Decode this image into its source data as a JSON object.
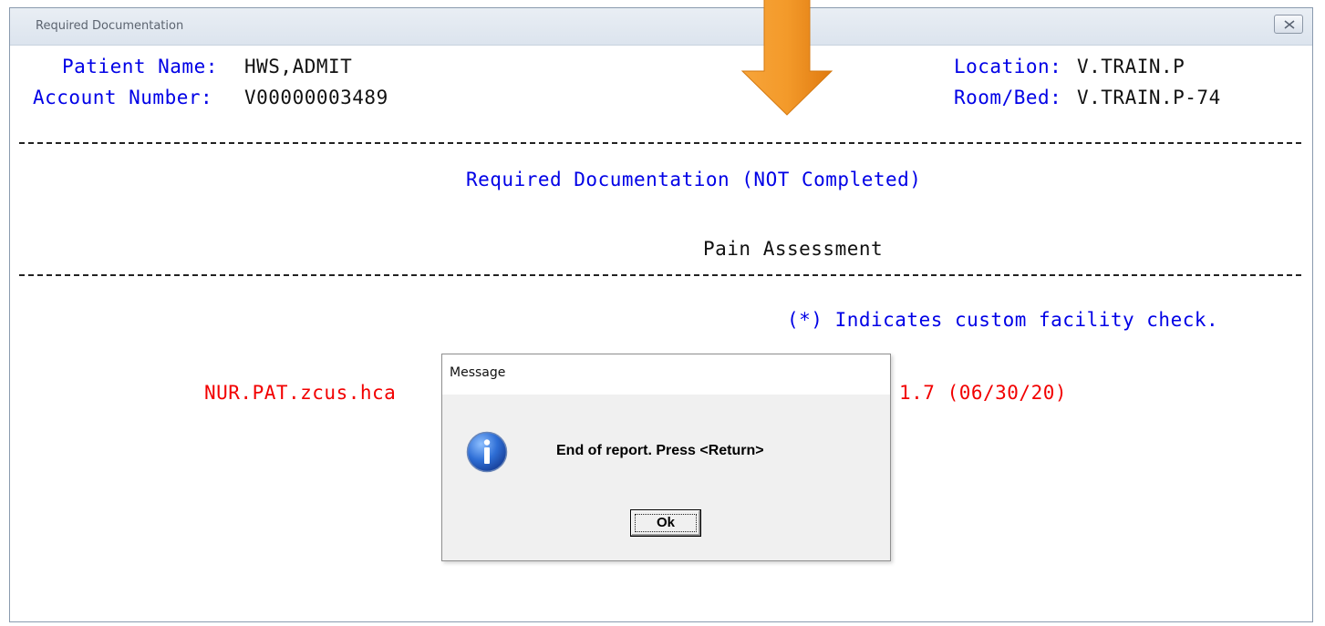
{
  "window": {
    "title": "Required Documentation"
  },
  "header": {
    "patient_name_label": "Patient Name:",
    "patient_name_value": "HWS,ADMIT",
    "account_number_label": "Account Number:",
    "account_number_value": "V00000003489",
    "location_label": "Location:",
    "location_value": "V.TRAIN.P",
    "room_bed_label": "Room/Bed:",
    "room_bed_value": "V.TRAIN.P-74"
  },
  "report": {
    "heading": "Required Documentation (NOT Completed)",
    "item": "Pain Assessment",
    "legend": "(*) Indicates custom facility check.",
    "footer_left": "NUR.PAT.zcus.hca",
    "footer_right": "1.7 (06/30/20)"
  },
  "dialog": {
    "title": "Message",
    "message": "End of report.  Press <Return>",
    "ok_label": "Ok",
    "icon": "info-icon"
  },
  "annotation": {
    "icon": "orange-down-arrow-icon",
    "color": "#f0901a"
  }
}
